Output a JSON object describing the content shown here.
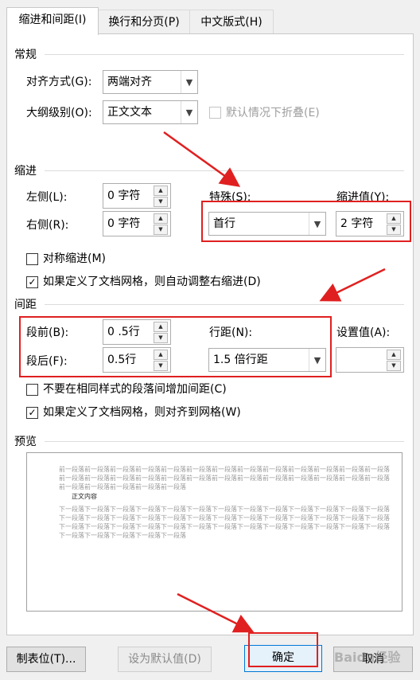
{
  "tabs": [
    {
      "label": "缩进和间距(I)"
    },
    {
      "label": "换行和分页(P)"
    },
    {
      "label": "中文版式(H)"
    }
  ],
  "general": {
    "title": "常规",
    "alignment_label": "对齐方式(G):",
    "alignment_value": "两端对齐",
    "outline_label": "大纲级别(O):",
    "outline_value": "正文文本",
    "collapse_label": "默认情况下折叠(E)"
  },
  "indent": {
    "title": "缩进",
    "left_label": "左侧(L):",
    "left_value": "0 字符",
    "right_label": "右侧(R):",
    "right_value": "0 字符",
    "special_label": "特殊(S):",
    "special_value": "首行",
    "indent_value_label": "缩进值(Y):",
    "indent_value": "2 字符",
    "mirror_label": "对称缩进(M)",
    "auto_adjust_label": "如果定义了文档网格，则自动调整右缩进(D)"
  },
  "spacing": {
    "title": "间距",
    "before_label": "段前(B):",
    "before_value": "0 .5行",
    "after_label": "段后(F):",
    "after_value": "0.5行",
    "line_label": "行距(N):",
    "line_value": "1.5 倍行距",
    "setting_label": "设置值(A):",
    "setting_value": "",
    "no_space_label": "不要在相同样式的段落间增加间距(C)",
    "snap_grid_label": "如果定义了文档网格，则对齐到网格(W)"
  },
  "preview": {
    "title": "预览",
    "prev_lines": [
      "前一段落前一段落前一段落前一段落前一段落前一段落前一段落前一段落前一段落前一段落前一段落前一段落前一段落",
      "前一段落前一段落前一段落前一段落前一段落前一段落前一段落前一段落前一段落前一段落前一段落前一段落前一段落",
      "前一段落前一段落前一段落前一段落前一段落"
    ],
    "main_text": "正文内容",
    "next_lines": [
      "下一段落下一段落下一段落下一段落下一段落下一段落下一段落下一段落下一段落下一段落下一段落下一段落下一段落",
      "下一段落下一段落下一段落下一段落下一段落下一段落下一段落下一段落下一段落下一段落下一段落下一段落下一段落",
      "下一段落下一段落下一段落下一段落下一段落下一段落下一段落下一段落下一段落下一段落下一段落下一段落下一段落",
      "下一段落下一段落下一段落下一段落下一段落"
    ]
  },
  "footer": {
    "tabs_button": "制表位(T)...",
    "default_button": "设为默认值(D)",
    "ok_button": "确定",
    "cancel_button": "取消"
  },
  "watermark": "Baidu经验",
  "colors": {
    "annotation_red": "#e02020",
    "panel_bg": "#ffffff",
    "dialog_bg": "#f0f0f0"
  }
}
